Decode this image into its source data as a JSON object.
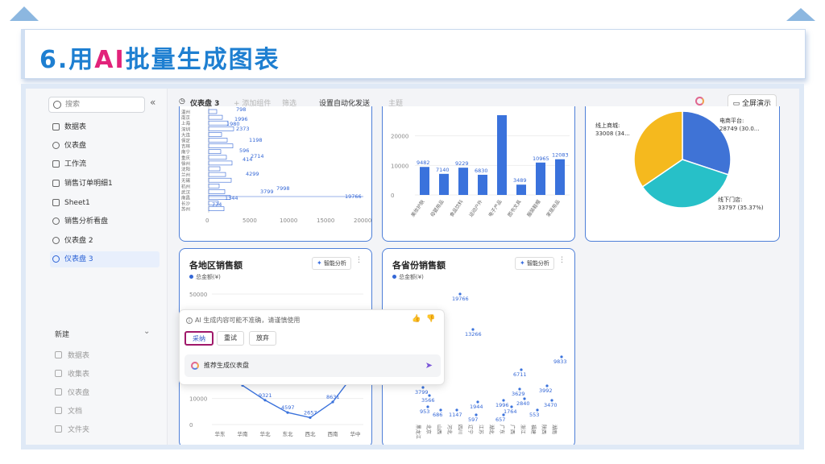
{
  "slide": {
    "title_prefix": "6.用",
    "title_ai": "AI",
    "title_suffix": "批量生成图表"
  },
  "sidebar": {
    "search_placeholder": "搜索",
    "collapse": "«",
    "items": [
      {
        "label": "数据表",
        "icon": "table-icon"
      },
      {
        "label": "仪表盘",
        "icon": "dashboard-icon"
      },
      {
        "label": "工作流",
        "icon": "workflow-icon"
      },
      {
        "label": "销售订单明细1",
        "icon": "table-icon"
      },
      {
        "label": "Sheet1",
        "icon": "table-icon"
      },
      {
        "label": "销售分析看盘",
        "icon": "dashboard-icon"
      },
      {
        "label": "仪表盘 2",
        "icon": "dashboard-icon"
      },
      {
        "label": "仪表盘 3",
        "icon": "dashboard-icon",
        "active": true
      }
    ],
    "new_label": "新建",
    "new_items": [
      "数据表",
      "收集表",
      "仪表盘",
      "文档",
      "文件夹"
    ]
  },
  "toolbar": {
    "dashboard_name": "仪表盘 3",
    "add_component": "+ 添加组件",
    "filter": "筛选",
    "automation": "设置自动化发送",
    "theme": "主题",
    "fullscreen": "全屏演示"
  },
  "cards": {
    "bar_h": {
      "cities": [
        "温州",
        "南京",
        "上海",
        "深圳",
        "大连",
        "保定",
        "吉林",
        "南宁",
        "重庆",
        "徐州",
        "沈阳",
        "兰州",
        "无锡",
        "杭州",
        "武汉",
        "南昌",
        "长沙",
        "苏州"
      ],
      "labels": [
        "774",
        "1344",
        "7998",
        "19766",
        "2714",
        "1198",
        "2373",
        "1980",
        "1996",
        "798",
        "596",
        "414",
        "3799",
        "4299"
      ],
      "xticks": [
        "0",
        "5000",
        "10000",
        "15000",
        "20000"
      ]
    },
    "bar_v": {
      "yticks": [
        "0",
        "10000",
        "20000"
      ],
      "values_labels": [
        "9482",
        "7140",
        "9229",
        "6830",
        "3489",
        "10965",
        "12083"
      ],
      "categories": [
        "美妆护肤",
        "母婴用品",
        "食品饮料",
        "运动户外",
        "电子产品",
        "图书文具",
        "服装鞋帽",
        "家居用品"
      ]
    },
    "pie": {
      "labels": [
        "线上商城:",
        "33008 (34...",
        "电商平台:",
        "28749 (30.0...",
        "线下门店:",
        "33797 (35.37%)"
      ]
    },
    "region": {
      "title": "各地区销售额",
      "smart": "智能分析",
      "legend": "总金额(¥)",
      "yticks": [
        "0",
        "10000",
        "50000"
      ],
      "categories": [
        "华东",
        "华南",
        "华北",
        "东北",
        "西北",
        "西南",
        "华中"
      ],
      "point_labels": [
        "9321",
        "4597",
        "2657",
        "8631"
      ]
    },
    "province": {
      "title": "各省份销售额",
      "smart": "智能分析",
      "legend": "总金额(¥)",
      "point_labels": [
        "19766",
        "13266",
        "9833",
        "6711",
        "3629",
        "3992",
        "3799",
        "3566",
        "2840",
        "3470",
        "1944",
        "1996",
        "953",
        "686",
        "1147",
        "597",
        "657",
        "1764",
        "553"
      ],
      "xlabels": [
        "黑龙江",
        "北京",
        "山西",
        "河北",
        "四川",
        "辽宁",
        "江苏",
        "湖北",
        "广东",
        "广西",
        "浙江",
        "福建",
        "陕西",
        "湖南"
      ]
    }
  },
  "popup": {
    "warning": "AI 生成内容可能不准确，请谨慎使用",
    "accept": "采纳",
    "retry": "重试",
    "discard": "放弃",
    "suggest": "推荐生成仪表盘"
  },
  "chart_data": [
    {
      "type": "bar",
      "title": "",
      "categories": [
        "美妆护肤",
        "母婴用品",
        "食品饮料",
        "运动户外",
        "电子产品",
        "图书文具",
        "服装鞋帽",
        "家居用品"
      ],
      "values": [
        9482,
        7140,
        9229,
        6830,
        27000,
        3489,
        10965,
        12083
      ],
      "ylim": [
        0,
        30000
      ]
    },
    {
      "type": "pie",
      "categories": [
        "电商平台",
        "线下门店",
        "线上商城"
      ],
      "values": [
        28749,
        33797,
        33008
      ],
      "colors": [
        "#3f73d6",
        "#27c0c8",
        "#f5b91e"
      ]
    },
    {
      "type": "line",
      "title": "各地区销售额",
      "categories": [
        "华东",
        "华南",
        "华北",
        "东北",
        "西北",
        "西南",
        "华中"
      ],
      "values": [
        22000,
        15000,
        9321,
        4597,
        2657,
        8631,
        20000
      ],
      "ylim": [
        0,
        50000
      ]
    }
  ]
}
